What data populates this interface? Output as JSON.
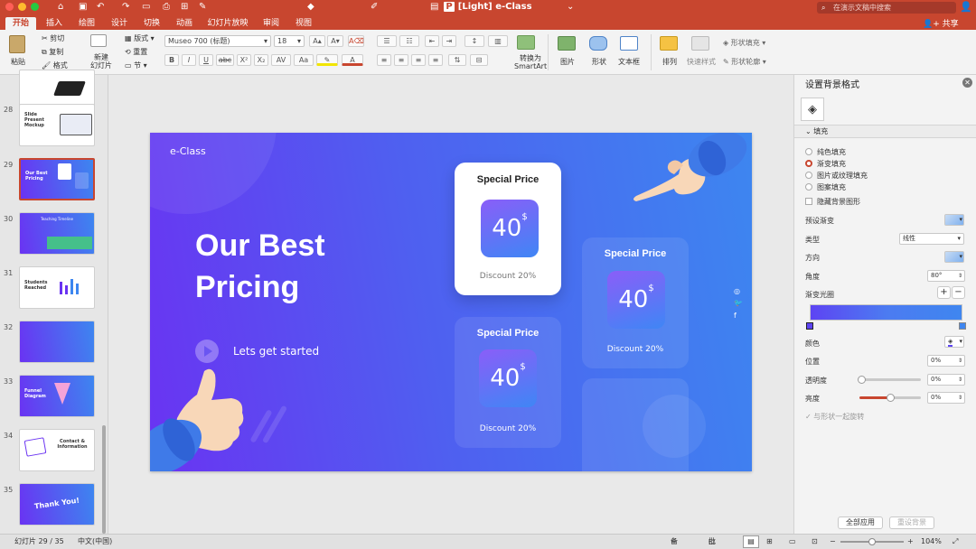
{
  "window": {
    "title": "[Light] e-Class",
    "doc_icon": "P"
  },
  "search": {
    "placeholder": "在演示文稿中搜索"
  },
  "share_label": "共享",
  "tabs": [
    "开始",
    "插入",
    "绘图",
    "设计",
    "切换",
    "动画",
    "幻灯片放映",
    "审阅",
    "视图"
  ],
  "ribbon": {
    "paste": "粘贴",
    "cut": "剪切",
    "copy": "复制",
    "format": "格式",
    "new_slide_line1": "新建",
    "new_slide_line2": "幻灯片",
    "layout": "版式",
    "reset": "重置",
    "section": "节",
    "font_name": "Museo 700 (标题)",
    "font_size": "18",
    "bold": "B",
    "italic": "I",
    "underline": "U",
    "strike": "abc",
    "superscript": "X²",
    "convert_smartart_1": "转换为",
    "convert_smartart_2": "SmartArt",
    "picture": "图片",
    "shape": "形状",
    "textbox": "文本框",
    "arrange": "排列",
    "quick_styles": "快速样式",
    "shape_fill": "形状填充",
    "shape_outline": "形状轮廓"
  },
  "thumbnails": [
    {
      "num": "28",
      "title": "Slide Present Mockup"
    },
    {
      "num": "29",
      "title": "Our Best Pricing"
    },
    {
      "num": "30",
      "title": "Teaching Timeline"
    },
    {
      "num": "31",
      "title": "Students Reached"
    },
    {
      "num": "32",
      "title": ""
    },
    {
      "num": "33",
      "title": "Funnel Diagram"
    },
    {
      "num": "34",
      "title": "Contact & Information"
    },
    {
      "num": "35",
      "title": "Thank You!"
    }
  ],
  "slide": {
    "logo": "e-Class",
    "headline_1": "Our Best",
    "headline_2": "Pricing",
    "cta": "Lets get started",
    "cards": [
      {
        "title": "Special Price",
        "price": "40",
        "currency": "$",
        "discount": "Discount 20%"
      },
      {
        "title": "Special Price",
        "price": "40",
        "currency": "$",
        "discount": "Discount 20%"
      },
      {
        "title": "Special Price",
        "price": "40",
        "currency": "$",
        "discount": "Discount 20%"
      }
    ],
    "social": [
      "◎",
      "🐦",
      "f"
    ]
  },
  "format_pane": {
    "title": "设置背景格式",
    "section_fill": "填充",
    "fill_options": [
      "纯色填充",
      "渐变填充",
      "图片或纹理填充",
      "图案填充"
    ],
    "selected_fill": "渐变填充",
    "hide_bg": "隐藏背景图形",
    "preset_gradient": "预设渐变",
    "type_label": "类型",
    "type_value": "线性",
    "direction_label": "方向",
    "angle_label": "角度",
    "angle_value": "80°",
    "stops_label": "渐变光圈",
    "color_label": "颜色",
    "position_label": "位置",
    "position_value": "0%",
    "transparency_label": "透明度",
    "transparency_value": "0%",
    "brightness_label": "亮度",
    "brightness_value": "0%",
    "rotate_with_shape": "与形状一起旋转",
    "apply_all": "全部应用",
    "reset_bg": "重设背景"
  },
  "statusbar": {
    "slide_info": "幻灯片 29 / 35",
    "language": "中文(中国)",
    "notes": "备注",
    "comments": "批注",
    "zoom": "104%"
  },
  "colors": {
    "accent": "#c8462f",
    "gradient_start": "#6a33f2",
    "gradient_end": "#3d86f0"
  }
}
